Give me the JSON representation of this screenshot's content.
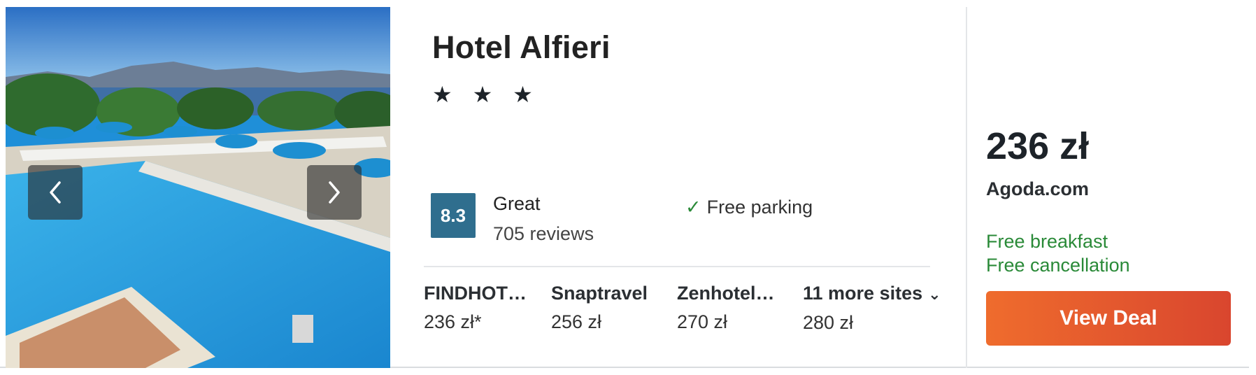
{
  "hotel": {
    "name": "Hotel Alfieri",
    "stars": "★ ★ ★",
    "rating_score": "8.3",
    "rating_label": "Great",
    "reviews": "705 reviews",
    "amenity_check": "✓",
    "amenity": "Free parking"
  },
  "photo": {
    "prev_icon": "chevron-left-icon",
    "next_icon": "chevron-right-icon"
  },
  "sites": [
    {
      "name": "FINDHOT…",
      "price": "236 zł*"
    },
    {
      "name": "Snaptravel",
      "price": "256 zł"
    },
    {
      "name": "Zenhotel…",
      "price": "270 zł"
    }
  ],
  "more_sites": {
    "label": "11 more sites",
    "chevron": "⌄",
    "price": "280 zł"
  },
  "deal": {
    "price": "236 zł",
    "provider": "Agoda.com",
    "perks": [
      "Free breakfast",
      "Free cancellation"
    ],
    "button_label": "View Deal"
  },
  "colors": {
    "rating_badge": "#2f6e8e",
    "perk_green": "#2a8a38",
    "button_start": "#ef6c2d",
    "button_end": "#d9462e"
  }
}
